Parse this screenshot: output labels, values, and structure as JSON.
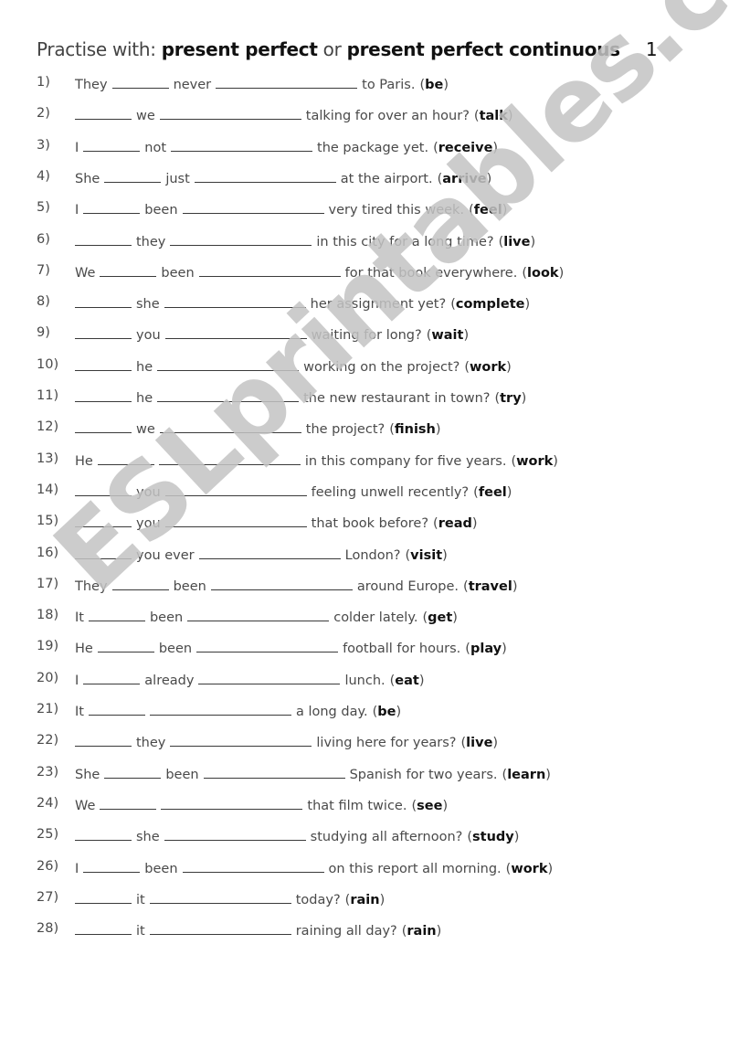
{
  "title": {
    "prefix": "Practise with:",
    "tense1": "present perfect",
    "connector": "or",
    "tense2": "present perfect continuous",
    "number": "1"
  },
  "watermark": "ESLprintables.com",
  "items": [
    {
      "num": "1)",
      "segs": [
        {
          "t": "text",
          "v": "They"
        },
        {
          "t": "blank",
          "w": "s"
        },
        {
          "t": "text",
          "v": "never"
        },
        {
          "t": "blank",
          "w": "l"
        },
        {
          "t": "text",
          "v": "to Paris."
        },
        {
          "t": "verb",
          "v": "be"
        }
      ]
    },
    {
      "num": "2)",
      "segs": [
        {
          "t": "blank",
          "w": "s"
        },
        {
          "t": "text",
          "v": "we"
        },
        {
          "t": "blank",
          "w": "l"
        },
        {
          "t": "text",
          "v": "talking for over an hour?"
        },
        {
          "t": "verb",
          "v": "talk"
        }
      ]
    },
    {
      "num": "3)",
      "segs": [
        {
          "t": "text",
          "v": "I"
        },
        {
          "t": "blank",
          "w": "s"
        },
        {
          "t": "text",
          "v": "not"
        },
        {
          "t": "blank",
          "w": "l"
        },
        {
          "t": "text",
          "v": "the package yet."
        },
        {
          "t": "verb",
          "v": "receive"
        }
      ]
    },
    {
      "num": "4)",
      "segs": [
        {
          "t": "text",
          "v": "She"
        },
        {
          "t": "blank",
          "w": "s"
        },
        {
          "t": "text",
          "v": "just"
        },
        {
          "t": "blank",
          "w": "l"
        },
        {
          "t": "text",
          "v": "at the airport."
        },
        {
          "t": "verb",
          "v": "arrive"
        }
      ]
    },
    {
      "num": "5)",
      "segs": [
        {
          "t": "text",
          "v": "I"
        },
        {
          "t": "blank",
          "w": "s"
        },
        {
          "t": "text",
          "v": "been"
        },
        {
          "t": "blank",
          "w": "l"
        },
        {
          "t": "text",
          "v": "very tired this week."
        },
        {
          "t": "verb",
          "v": "feel"
        }
      ]
    },
    {
      "num": "6)",
      "segs": [
        {
          "t": "blank",
          "w": "s"
        },
        {
          "t": "text",
          "v": "they"
        },
        {
          "t": "blank",
          "w": "l"
        },
        {
          "t": "text",
          "v": "in this city for a long time?"
        },
        {
          "t": "verb",
          "v": "live"
        }
      ]
    },
    {
      "num": "7)",
      "segs": [
        {
          "t": "text",
          "v": "We"
        },
        {
          "t": "blank",
          "w": "s"
        },
        {
          "t": "text",
          "v": "been"
        },
        {
          "t": "blank",
          "w": "l"
        },
        {
          "t": "text",
          "v": "for that book everywhere."
        },
        {
          "t": "verb",
          "v": "look"
        }
      ]
    },
    {
      "num": "8)",
      "segs": [
        {
          "t": "blank",
          "w": "s"
        },
        {
          "t": "text",
          "v": "she"
        },
        {
          "t": "blank",
          "w": "l"
        },
        {
          "t": "text",
          "v": "her assignment yet?"
        },
        {
          "t": "verb",
          "v": "complete"
        }
      ]
    },
    {
      "num": "9)",
      "segs": [
        {
          "t": "blank",
          "w": "s"
        },
        {
          "t": "text",
          "v": "you"
        },
        {
          "t": "blank",
          "w": "l"
        },
        {
          "t": "text",
          "v": "waiting for long?"
        },
        {
          "t": "verb",
          "v": "wait"
        }
      ]
    },
    {
      "num": "10)",
      "segs": [
        {
          "t": "blank",
          "w": "s"
        },
        {
          "t": "text",
          "v": "he"
        },
        {
          "t": "blank",
          "w": "l"
        },
        {
          "t": "text",
          "v": "working on the project?"
        },
        {
          "t": "verb",
          "v": "work"
        }
      ]
    },
    {
      "num": "11)",
      "segs": [
        {
          "t": "blank",
          "w": "s"
        },
        {
          "t": "text",
          "v": "he"
        },
        {
          "t": "blank",
          "w": "l"
        },
        {
          "t": "text",
          "v": "the new restaurant in town?"
        },
        {
          "t": "verb",
          "v": "try"
        }
      ]
    },
    {
      "num": "12)",
      "segs": [
        {
          "t": "blank",
          "w": "s"
        },
        {
          "t": "text",
          "v": "we"
        },
        {
          "t": "blank",
          "w": "l"
        },
        {
          "t": "text",
          "v": "the project?"
        },
        {
          "t": "verb",
          "v": "finish"
        }
      ]
    },
    {
      "num": "13)",
      "segs": [
        {
          "t": "text",
          "v": "He"
        },
        {
          "t": "blank",
          "w": "s"
        },
        {
          "t": "blank",
          "w": "l"
        },
        {
          "t": "text",
          "v": "in this company for five years."
        },
        {
          "t": "verb",
          "v": "work"
        }
      ]
    },
    {
      "num": "14)",
      "segs": [
        {
          "t": "blank",
          "w": "s"
        },
        {
          "t": "text",
          "v": "you"
        },
        {
          "t": "blank",
          "w": "l"
        },
        {
          "t": "text",
          "v": "feeling unwell recently?"
        },
        {
          "t": "verb",
          "v": "feel"
        }
      ]
    },
    {
      "num": "15)",
      "segs": [
        {
          "t": "blank",
          "w": "s"
        },
        {
          "t": "text",
          "v": "you"
        },
        {
          "t": "blank",
          "w": "l"
        },
        {
          "t": "text",
          "v": "that book before?"
        },
        {
          "t": "verb",
          "v": "read"
        }
      ]
    },
    {
      "num": "16)",
      "segs": [
        {
          "t": "blank",
          "w": "s"
        },
        {
          "t": "text",
          "v": "you ever"
        },
        {
          "t": "blank",
          "w": "l"
        },
        {
          "t": "text",
          "v": "London?"
        },
        {
          "t": "verb",
          "v": "visit"
        }
      ]
    },
    {
      "num": "17)",
      "segs": [
        {
          "t": "text",
          "v": "They"
        },
        {
          "t": "blank",
          "w": "s"
        },
        {
          "t": "text",
          "v": "been"
        },
        {
          "t": "blank",
          "w": "l"
        },
        {
          "t": "text",
          "v": "around Europe."
        },
        {
          "t": "verb",
          "v": "travel"
        }
      ]
    },
    {
      "num": "18)",
      "segs": [
        {
          "t": "text",
          "v": "It"
        },
        {
          "t": "blank",
          "w": "s"
        },
        {
          "t": "text",
          "v": "been"
        },
        {
          "t": "blank",
          "w": "l"
        },
        {
          "t": "text",
          "v": "colder lately."
        },
        {
          "t": "verb",
          "v": "get"
        }
      ]
    },
    {
      "num": "19)",
      "segs": [
        {
          "t": "text",
          "v": "He"
        },
        {
          "t": "blank",
          "w": "s"
        },
        {
          "t": "text",
          "v": "been"
        },
        {
          "t": "blank",
          "w": "l"
        },
        {
          "t": "text",
          "v": "football for hours."
        },
        {
          "t": "verb",
          "v": "play"
        }
      ]
    },
    {
      "num": "20)",
      "segs": [
        {
          "t": "text",
          "v": "I"
        },
        {
          "t": "blank",
          "w": "s"
        },
        {
          "t": "text",
          "v": "already"
        },
        {
          "t": "blank",
          "w": "l"
        },
        {
          "t": "text",
          "v": "lunch."
        },
        {
          "t": "verb",
          "v": "eat"
        }
      ]
    },
    {
      "num": "21)",
      "segs": [
        {
          "t": "text",
          "v": "It"
        },
        {
          "t": "blank",
          "w": "s"
        },
        {
          "t": "blank",
          "w": "l"
        },
        {
          "t": "text",
          "v": "a long day."
        },
        {
          "t": "verb",
          "v": "be"
        }
      ]
    },
    {
      "num": "22)",
      "segs": [
        {
          "t": "blank",
          "w": "s"
        },
        {
          "t": "text",
          "v": "they"
        },
        {
          "t": "blank",
          "w": "l"
        },
        {
          "t": "text",
          "v": "living here for years?"
        },
        {
          "t": "verb",
          "v": "live"
        }
      ]
    },
    {
      "num": "23)",
      "segs": [
        {
          "t": "text",
          "v": "She"
        },
        {
          "t": "blank",
          "w": "s"
        },
        {
          "t": "text",
          "v": "been"
        },
        {
          "t": "blank",
          "w": "l"
        },
        {
          "t": "text",
          "v": "Spanish for two years."
        },
        {
          "t": "verb",
          "v": "learn"
        }
      ]
    },
    {
      "num": "24)",
      "segs": [
        {
          "t": "text",
          "v": "We"
        },
        {
          "t": "blank",
          "w": "s"
        },
        {
          "t": "blank",
          "w": "l"
        },
        {
          "t": "text",
          "v": "that film twice."
        },
        {
          "t": "verb",
          "v": "see"
        }
      ]
    },
    {
      "num": "25)",
      "segs": [
        {
          "t": "blank",
          "w": "s"
        },
        {
          "t": "text",
          "v": "she"
        },
        {
          "t": "blank",
          "w": "l"
        },
        {
          "t": "text",
          "v": "studying all afternoon?"
        },
        {
          "t": "verb",
          "v": "study"
        }
      ]
    },
    {
      "num": "26)",
      "segs": [
        {
          "t": "text",
          "v": "I"
        },
        {
          "t": "blank",
          "w": "s"
        },
        {
          "t": "text",
          "v": "been"
        },
        {
          "t": "blank",
          "w": "l"
        },
        {
          "t": "text",
          "v": "on this report all morning."
        },
        {
          "t": "verb",
          "v": "work"
        }
      ]
    },
    {
      "num": "27)",
      "segs": [
        {
          "t": "blank",
          "w": "s"
        },
        {
          "t": "text",
          "v": "it"
        },
        {
          "t": "blank",
          "w": "l"
        },
        {
          "t": "text",
          "v": "today?"
        },
        {
          "t": "verb",
          "v": "rain"
        }
      ]
    },
    {
      "num": "28)",
      "segs": [
        {
          "t": "blank",
          "w": "s"
        },
        {
          "t": "text",
          "v": "it"
        },
        {
          "t": "blank",
          "w": "l"
        },
        {
          "t": "text",
          "v": "raining all day?"
        },
        {
          "t": "verb",
          "v": "rain"
        }
      ]
    }
  ]
}
